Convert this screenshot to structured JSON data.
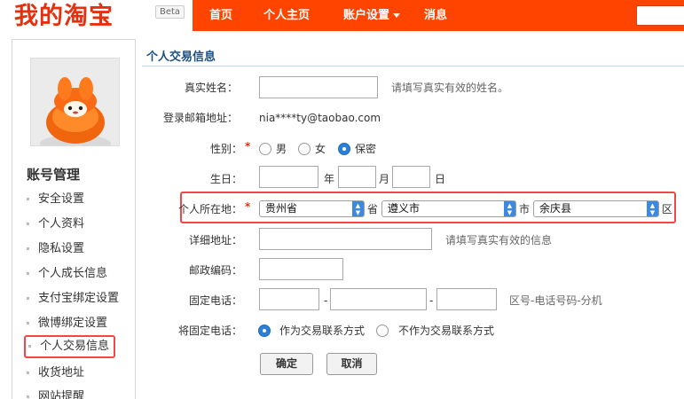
{
  "header": {
    "logo": "我的淘宝",
    "beta": "Beta",
    "nav": [
      {
        "label": "首页"
      },
      {
        "label": "个人主页"
      },
      {
        "label": "账户设置"
      },
      {
        "label": "消息"
      }
    ]
  },
  "sidebar": {
    "title": "账号管理",
    "items": [
      {
        "label": "安全设置"
      },
      {
        "label": "个人资料"
      },
      {
        "label": "隐私设置"
      },
      {
        "label": "个人成长信息"
      },
      {
        "label": "支付宝绑定设置"
      },
      {
        "label": "微博绑定设置"
      },
      {
        "label": "个人交易信息"
      },
      {
        "label": "收货地址"
      },
      {
        "label": "网站提醒"
      }
    ],
    "active_index": 6
  },
  "main": {
    "title": "个人交易信息",
    "real_name": {
      "label": "真实姓名：",
      "value": "",
      "hint": "请填写真实有效的姓名。"
    },
    "email": {
      "label": "登录邮箱地址：",
      "value": "nia****ty@taobao.com"
    },
    "gender": {
      "label": "性别：",
      "req": "*",
      "options": [
        "男",
        "女",
        "保密"
      ],
      "selected": "保密"
    },
    "birthday": {
      "label": "生日：",
      "year_unit": "年",
      "month_unit": "月",
      "day_unit": "日"
    },
    "location": {
      "label": "个人所在地：",
      "req": "*",
      "province": "贵州省",
      "province_unit": "省",
      "city": "遵义市",
      "city_unit": "市",
      "district": "余庆县",
      "district_unit": "区"
    },
    "address": {
      "label": "详细地址：",
      "value": "",
      "hint": "请填写真实有效的信息"
    },
    "postcode": {
      "label": "邮政编码：",
      "value": ""
    },
    "phone": {
      "label": "固定电话：",
      "sep": "-",
      "hint": "区号-电话号码-分机"
    },
    "phone_use": {
      "label": "将固定电话：",
      "options": [
        "作为交易联系方式",
        "不作为交易联系方式"
      ],
      "selected": "作为交易联系方式"
    },
    "buttons": {
      "confirm": "确定",
      "cancel": "取消"
    }
  }
}
